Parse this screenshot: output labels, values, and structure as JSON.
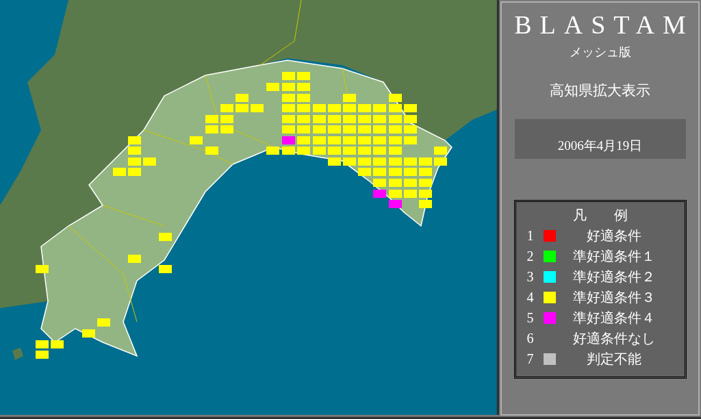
{
  "panel": {
    "title": "BLASTAM",
    "subtitle": "メッシュ版",
    "region": "高知県拡大表示",
    "date": "2006年4月19日"
  },
  "legend": {
    "title": "凡例",
    "items": [
      {
        "number": "1",
        "label": "好適条件",
        "color": "#ff0000"
      },
      {
        "number": "2",
        "label": "準好適条件１",
        "color": "#00ff00"
      },
      {
        "number": "3",
        "label": "準好適条件２",
        "color": "#00ffff"
      },
      {
        "number": "4",
        "label": "準好適条件３",
        "color": "#ffff00"
      },
      {
        "number": "5",
        "label": "準好適条件４",
        "color": "#ff00ff"
      },
      {
        "number": "6",
        "label": "好適条件なし"
      },
      {
        "number": "7",
        "label": "判定不能",
        "color": "#c0c0c0"
      }
    ]
  }
}
